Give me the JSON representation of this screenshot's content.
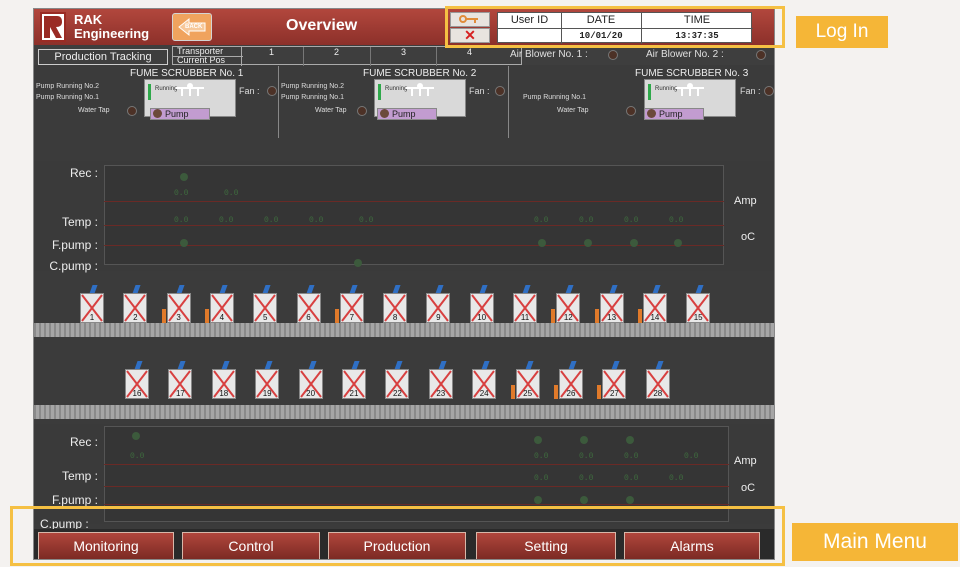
{
  "header": {
    "brand_line1": "RAK",
    "brand_line2": "Engineering",
    "back_label": "BACK",
    "title": "Overview",
    "x_symbol": "✕"
  },
  "info": {
    "user_id_label": "User ID",
    "date_label": "DATE",
    "time_label": "TIME",
    "user_id": "",
    "date": "10/01/20",
    "time": "13:37:35"
  },
  "tracking": {
    "button": "Production Tracking",
    "transporter_label": "Transporter",
    "current_pos_label": "Current Pos",
    "columns": [
      "1",
      "2",
      "3",
      "4"
    ]
  },
  "blowers": {
    "b1": "Air Blower No. 1 :",
    "b2": "Air Blower No. 2 :"
  },
  "scrubbers": [
    {
      "title": "FUME SCRUBBER No. 1",
      "p2": "Pump Running No.2",
      "p1": "Pump Running No.1",
      "tap": "Water Tap",
      "fan": "Fan :",
      "pump": "Pump",
      "running": "Running"
    },
    {
      "title": "FUME SCRUBBER No. 2",
      "p2": "Pump Running No.2",
      "p1": "Pump Running No.1",
      "tap": "Water Tap",
      "fan": "Fan :",
      "pump": "Pump",
      "running": "Running"
    },
    {
      "title": "FUME SCRUBBER No. 3",
      "p2": "",
      "p1": "Pump Running No.1",
      "tap": "Water Tap",
      "fan": "Fan :",
      "pump": "Pump",
      "running": "Running"
    }
  ],
  "top_panel": {
    "rec": "Rec :",
    "temp": "Temp :",
    "fpump": "F.pump :",
    "cpump": "C.pump :",
    "amp": "Amp",
    "oc": "oC"
  },
  "bottom_panel": {
    "rec": "Rec :",
    "temp": "Temp :",
    "fpump": "F.pump :",
    "cpump": "C.pump :",
    "amp": "Amp",
    "oc": "oC"
  },
  "tanks_row1": [
    "1",
    "2",
    "3",
    "4",
    "5",
    "6",
    "7",
    "8",
    "9",
    "10",
    "11",
    "12",
    "13",
    "14",
    "15"
  ],
  "tanks_row2": [
    "16",
    "17",
    "18",
    "19",
    "20",
    "21",
    "22",
    "23",
    "24",
    "25",
    "26",
    "27",
    "28"
  ],
  "zero_value": "0.0",
  "menu": [
    "Monitoring",
    "Control",
    "Production",
    "Setting",
    "Alarms"
  ],
  "annotations": {
    "login": "Log In",
    "main_menu": "Main Menu"
  },
  "colors": {
    "header": "#9a3b33",
    "menu_button": "#a23d34",
    "annotation": "#f5b637",
    "tank_arm": "#2f6fc4",
    "tank_cross": "#d84040"
  }
}
